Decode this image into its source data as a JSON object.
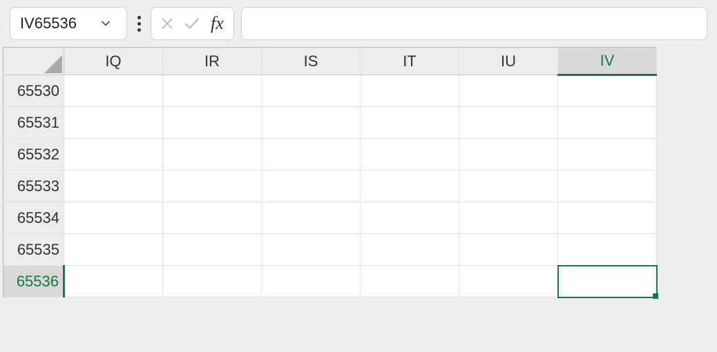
{
  "formula_bar": {
    "name_box_value": "IV65536",
    "formula_value": ""
  },
  "grid": {
    "columns": [
      "IQ",
      "IR",
      "IS",
      "IT",
      "IU",
      "IV"
    ],
    "rows": [
      "65530",
      "65531",
      "65532",
      "65533",
      "65534",
      "65535",
      "65536"
    ],
    "active_column": "IV",
    "active_row": "65536",
    "cells": {}
  }
}
